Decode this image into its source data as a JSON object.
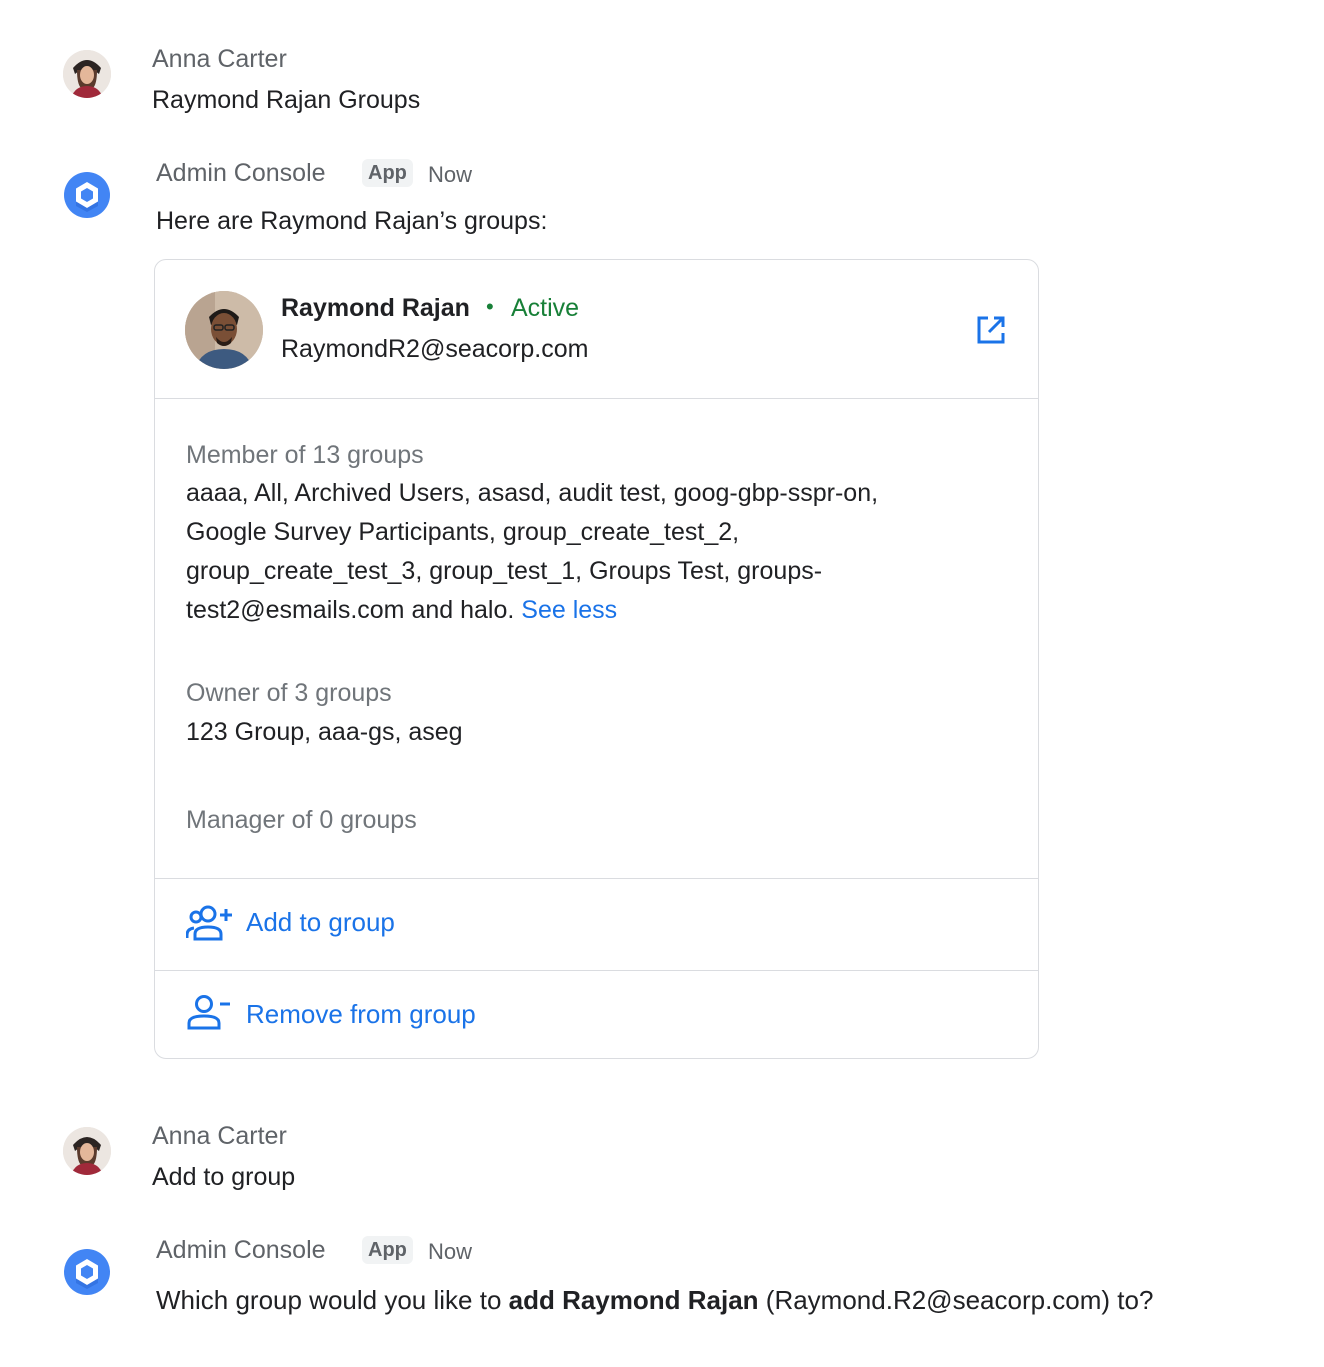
{
  "messages": [
    {
      "sender": "Anna Carter",
      "text": "Raymond Rajan Groups"
    },
    {
      "sender": "Admin Console",
      "app_chip": "App",
      "time": "Now",
      "text": "Here are Raymond Rajan’s groups:"
    },
    {
      "sender": "Anna Carter",
      "text": "Add to group"
    },
    {
      "sender": "Admin Console",
      "app_chip": "App",
      "time": "Now",
      "text_prefix": "Which group would you like to ",
      "text_bold": "add Raymond Rajan",
      "text_suffix": " (Raymond.R2@seacorp.com) to?"
    }
  ],
  "card": {
    "name": "Raymond Rajan",
    "status_dot": "•",
    "status": "Active",
    "email": "RaymondR2@seacorp.com",
    "member_label": "Member of 13 groups",
    "member_lines": [
      "aaaa, All, Archived Users, asasd, audit test, goog-gbp-sspr-on,",
      "Google Survey Participants, group_create_test_2,",
      "group_create_test_3, group_test_1, Groups Test, groups-",
      "test2@esmails.com and halo."
    ],
    "see_less": "See less",
    "owner_label": "Owner of 3 groups",
    "owner_groups": "123 Group, aaa-gs, aseg",
    "manager_label": "Manager of 0 groups",
    "add_label": "Add to group",
    "remove_label": "Remove from group"
  },
  "icons": {
    "open": "open-in-new-icon",
    "add": "group-add-icon",
    "remove": "person-remove-icon",
    "app": "admin-console-logo"
  },
  "colors": {
    "accent": "#1a73e8",
    "active": "#188038",
    "secondary_text": "#5f6368",
    "border": "#dadce0"
  }
}
